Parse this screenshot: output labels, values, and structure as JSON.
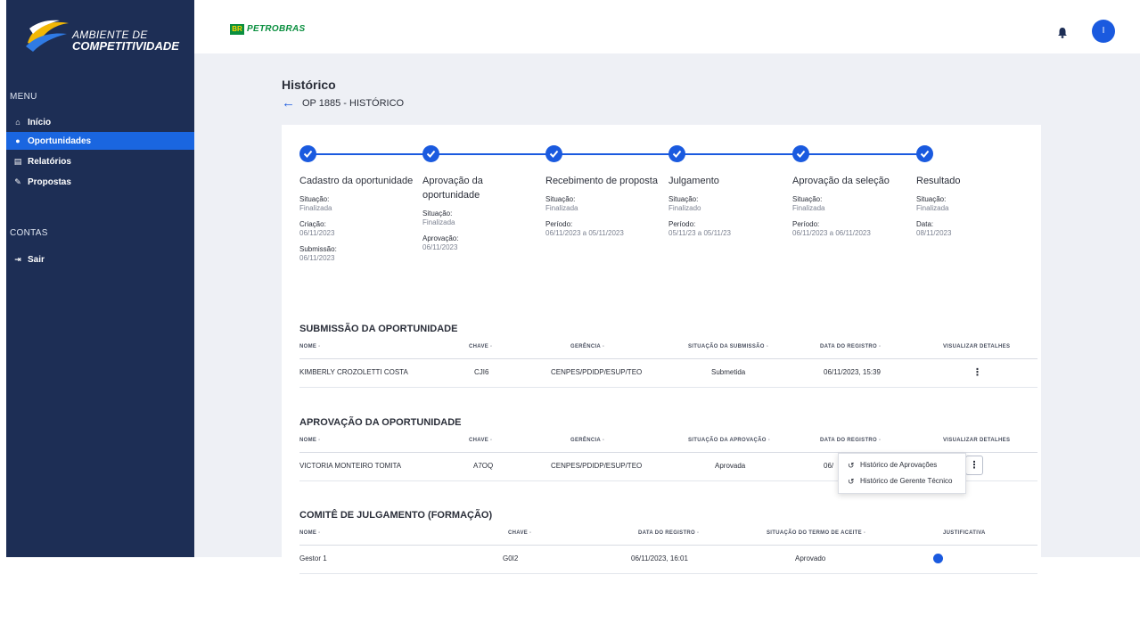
{
  "brand": {
    "line1": "AMBIENTE DE",
    "line2": "COMPETITIVIDADE"
  },
  "sidebar": {
    "menu_label": "MENU",
    "items": [
      {
        "label": "Início",
        "icon": "home-icon",
        "glyph": "⌂"
      },
      {
        "label": "Oportunidades",
        "icon": "lightbulb-icon",
        "glyph": "💡"
      },
      {
        "label": "Relatórios",
        "icon": "document-icon",
        "glyph": "▤"
      },
      {
        "label": "Propostas",
        "icon": "edit-icon",
        "glyph": "✎"
      }
    ],
    "contas_label": "CONTAS",
    "logout": {
      "label": "Sair",
      "icon": "logout-icon",
      "glyph": "⇥"
    }
  },
  "topbar": {
    "petro_flag": "BR",
    "petro_name": "PETROBRAS",
    "avatar_initial": "I"
  },
  "page": {
    "title": "Histórico",
    "breadcrumb": "OP 1885 - HISTÓRICO"
  },
  "steps": [
    {
      "title": "Cadastro da oportunidade",
      "fields": [
        {
          "label": "Situação:",
          "value": "Finalizada"
        },
        {
          "label": "Criação:",
          "value": "06/11/2023"
        },
        {
          "label": "Submissão:",
          "value": "06/11/2023"
        }
      ]
    },
    {
      "title": "Aprovação da oportunidade",
      "fields": [
        {
          "label": "Situação:",
          "value": "Finalizada"
        },
        {
          "label": "Aprovação:",
          "value": "06/11/2023"
        }
      ]
    },
    {
      "title": "Recebimento de proposta",
      "fields": [
        {
          "label": "Situação:",
          "value": "Finalizada"
        },
        {
          "label": "Período:",
          "value": "06/11/2023  a 05/11/2023"
        }
      ]
    },
    {
      "title": "Julgamento",
      "fields": [
        {
          "label": "Situação:",
          "value": "Finalizado"
        },
        {
          "label": "Período:",
          "value": "05/11/23  a 05/11/23"
        }
      ]
    },
    {
      "title": "Aprovação da seleção",
      "fields": [
        {
          "label": "Situação:",
          "value": "Finalizada"
        },
        {
          "label": "Período:",
          "value": "06/11/2023  a 06/11/2023"
        }
      ]
    },
    {
      "title": "Resultado",
      "fields": [
        {
          "label": "Situação:",
          "value": "Finalizada"
        },
        {
          "label": "Data:",
          "value": "08/11/2023"
        }
      ]
    }
  ],
  "submissao": {
    "title": "SUBMISSÃO DA OPORTUNIDADE",
    "headers": [
      "NOME ◦",
      "CHAVE ◦",
      "GERÊNCIA ◦",
      "SITUAÇÃO DA SUBMISSÃO ◦",
      "DATA DO REGISTRO ◦",
      "VISUALIZAR DETALHES"
    ],
    "row": {
      "nome": "KIMBERLY CROZOLETTI COSTA",
      "chave": "CJI6",
      "gerencia": "CENPES/PDIDP/ESUP/TEO",
      "situacao": "Submetida",
      "data": "06/11/2023, 15:39"
    }
  },
  "aprovacao": {
    "title": "APROVAÇÃO DA OPORTUNIDADE",
    "headers": [
      "NOME ◦",
      "CHAVE ◦",
      "GERÊNCIA ◦",
      "SITUAÇÃO DA APROVAÇÃO ◦",
      "DATA DO REGISTRO ◦",
      "VISUALIZAR DETALHES"
    ],
    "row": {
      "nome": "VICTORIA MONTEIRO TOMITA",
      "chave": "A7OQ",
      "gerencia": "CENPES/PDIDP/ESUP/TEO",
      "situacao": "Aprovada",
      "data": "06/"
    }
  },
  "popup_menu": {
    "item1": "Histórico de Aprovações",
    "item2": "Histórico de Gerente Técnico"
  },
  "comite": {
    "title": "COMITÊ DE JULGAMENTO (FORMAÇÃO)",
    "headers": [
      "NOME ◦",
      "CHAVE ◦",
      "DATA DO REGISTRO ◦",
      "SITUAÇÃO DO TERMO DE ACEITE ◦",
      "JUSTIFICATIVA"
    ],
    "row": {
      "nome": "Gestor 1",
      "chave": "G0I2",
      "data": "06/11/2023, 16:01",
      "situacao": "Aprovado"
    }
  }
}
